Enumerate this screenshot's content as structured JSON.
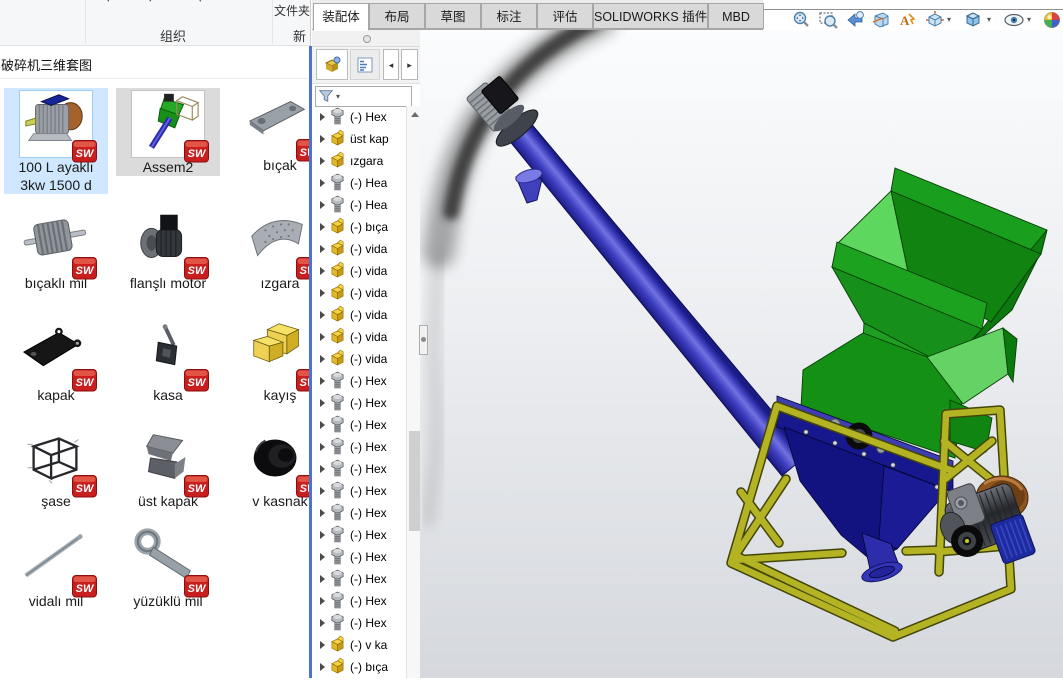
{
  "explorer": {
    "ribbon": {
      "folder_label": "文件夹",
      "organize": "组织",
      "new_partial": "新"
    },
    "title": "破碎机三维套图",
    "items": [
      {
        "label_lines": [
          "100 L ayaklı",
          "3kw 1500 d"
        ],
        "thumb": "blue-motor",
        "selected": "active"
      },
      {
        "label_lines": [
          "Assem2"
        ],
        "thumb": "assembly-mini",
        "selected": "inactive"
      },
      {
        "label_lines": [
          "bıçak"
        ],
        "thumb": "flat-bar"
      },
      {
        "label_lines": [
          "bıçaklı mil"
        ],
        "thumb": "bladed-shaft"
      },
      {
        "label_lines": [
          "flanşlı motor"
        ],
        "thumb": "flanged-motor"
      },
      {
        "label_lines": [
          "ızgara"
        ],
        "thumb": "curved-grate"
      },
      {
        "label_lines": [
          "kapak"
        ],
        "thumb": "black-cover"
      },
      {
        "label_lines": [
          "kasa"
        ],
        "thumb": "small-bracket"
      },
      {
        "label_lines": [
          "kayış"
        ],
        "thumb": "yellow-block"
      },
      {
        "label_lines": [
          "şase"
        ],
        "thumb": "wireframe-frame"
      },
      {
        "label_lines": [
          "üst kapak"
        ],
        "thumb": "top-cover"
      },
      {
        "label_lines": [
          "v kasnak"
        ],
        "thumb": "v-pulley"
      },
      {
        "label_lines": [
          "vidalı mil"
        ],
        "thumb": "threaded-rod"
      },
      {
        "label_lines": [
          "yüzüklü mil"
        ],
        "thumb": "ringed-shaft"
      }
    ]
  },
  "sw": {
    "tabs": [
      {
        "label": "装配体",
        "active": true
      },
      {
        "label": "布局"
      },
      {
        "label": "草图"
      },
      {
        "label": "标注"
      },
      {
        "label": "评估"
      },
      {
        "label": "SOLIDWORKS 插件"
      },
      {
        "label": "MBD"
      }
    ],
    "headsup": [
      "zoom-fit",
      "zoom-area",
      "previous-view",
      "section-view",
      "annotation-visibility",
      "view-orientation",
      "display-style",
      "hide-show-items",
      "edit-appearance"
    ],
    "tree_items": [
      {
        "icon": "fastener",
        "label": "(-) Hex"
      },
      {
        "icon": "part",
        "label": "üst kap"
      },
      {
        "icon": "part",
        "label": "ızgara"
      },
      {
        "icon": "fastener",
        "label": "(-) Hea"
      },
      {
        "icon": "fastener",
        "label": "(-) Hea"
      },
      {
        "icon": "part",
        "label": "(-) bıça"
      },
      {
        "icon": "part",
        "label": "(-) vida"
      },
      {
        "icon": "part",
        "label": "(-) vida"
      },
      {
        "icon": "part",
        "label": "(-) vida"
      },
      {
        "icon": "part",
        "label": "(-) vida"
      },
      {
        "icon": "part",
        "label": "(-) vida"
      },
      {
        "icon": "part",
        "label": "(-) vida"
      },
      {
        "icon": "fastener",
        "label": "(-) Hex"
      },
      {
        "icon": "fastener",
        "label": "(-) Hex"
      },
      {
        "icon": "fastener",
        "label": "(-) Hex"
      },
      {
        "icon": "fastener",
        "label": "(-) Hex"
      },
      {
        "icon": "fastener",
        "label": "(-) Hex"
      },
      {
        "icon": "fastener",
        "label": "(-) Hex"
      },
      {
        "icon": "fastener",
        "label": "(-) Hex"
      },
      {
        "icon": "fastener",
        "label": "(-) Hex"
      },
      {
        "icon": "fastener",
        "label": "(-) Hex"
      },
      {
        "icon": "fastener",
        "label": "(-) Hex"
      },
      {
        "icon": "fastener",
        "label": "(-) Hex"
      },
      {
        "icon": "fastener",
        "label": "(-) Hex"
      },
      {
        "icon": "part",
        "label": "(-) v ka"
      },
      {
        "icon": "part",
        "label": "(-) bıça"
      }
    ]
  },
  "colors": {
    "hopper_green": "#1ba11b",
    "hopper_light_green": "#5ed75e",
    "conveyor_blue": "#3c3cc2",
    "base_navy": "#16168e",
    "frame_yellow": "#b9b92b",
    "selection_blue": "#cfe8ff"
  }
}
